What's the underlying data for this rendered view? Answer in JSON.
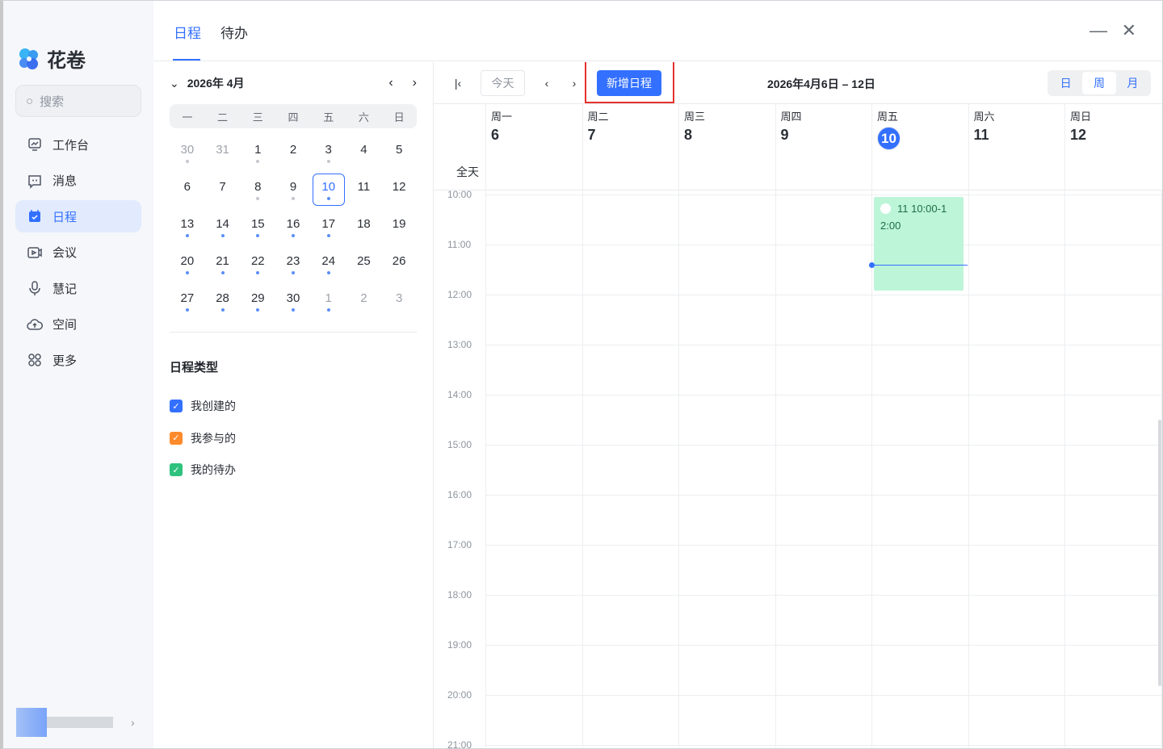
{
  "app": {
    "name": "花卷"
  },
  "sidebar": {
    "search_placeholder": "搜索",
    "items": [
      {
        "label": "工作台",
        "icon": "dashboard-icon"
      },
      {
        "label": "消息",
        "icon": "message-icon"
      },
      {
        "label": "日程",
        "icon": "calendar-icon",
        "active": true
      },
      {
        "label": "会议",
        "icon": "video-icon"
      },
      {
        "label": "慧记",
        "icon": "mic-icon"
      },
      {
        "label": "空间",
        "icon": "cloud-icon"
      },
      {
        "label": "更多",
        "icon": "grid-icon"
      }
    ]
  },
  "tabs": [
    {
      "label": "日程",
      "active": true
    },
    {
      "label": "待办"
    }
  ],
  "window": {
    "minimize": "—",
    "close": "✕"
  },
  "mini_calendar": {
    "title": "2026年 4月",
    "weekdays": [
      "一",
      "二",
      "三",
      "四",
      "五",
      "六",
      "日"
    ],
    "days": [
      {
        "d": "30",
        "o": 1,
        "dot": "g"
      },
      {
        "d": "31",
        "o": 1,
        "dot": "n"
      },
      {
        "d": "1",
        "dot": "g"
      },
      {
        "d": "2",
        "dot": "n"
      },
      {
        "d": "3",
        "dot": "g"
      },
      {
        "d": "4",
        "dot": "n"
      },
      {
        "d": "5",
        "dot": "n"
      },
      {
        "d": "6",
        "dot": "n"
      },
      {
        "d": "7",
        "dot": "n"
      },
      {
        "d": "8",
        "dot": "g"
      },
      {
        "d": "9",
        "dot": "g"
      },
      {
        "d": "10",
        "dot": "b",
        "sel": 1
      },
      {
        "d": "11",
        "dot": "n"
      },
      {
        "d": "12",
        "dot": "n"
      },
      {
        "d": "13",
        "dot": "b"
      },
      {
        "d": "14",
        "dot": "b"
      },
      {
        "d": "15",
        "dot": "b"
      },
      {
        "d": "16",
        "dot": "b"
      },
      {
        "d": "17",
        "dot": "b"
      },
      {
        "d": "18",
        "dot": "n"
      },
      {
        "d": "19",
        "dot": "n"
      },
      {
        "d": "20",
        "dot": "b"
      },
      {
        "d": "21",
        "dot": "b"
      },
      {
        "d": "22",
        "dot": "b"
      },
      {
        "d": "23",
        "dot": "b"
      },
      {
        "d": "24",
        "dot": "b"
      },
      {
        "d": "25",
        "dot": "n"
      },
      {
        "d": "26",
        "dot": "n"
      },
      {
        "d": "27",
        "dot": "b"
      },
      {
        "d": "28",
        "dot": "b"
      },
      {
        "d": "29",
        "dot": "b"
      },
      {
        "d": "30",
        "dot": "b"
      },
      {
        "d": "1",
        "o": 1,
        "dot": "b"
      },
      {
        "d": "2",
        "o": 1,
        "dot": "n"
      },
      {
        "d": "3",
        "o": 1,
        "dot": "n"
      }
    ]
  },
  "schedule_types": {
    "title": "日程类型",
    "items": [
      {
        "label": "我创建的",
        "color": "#3370ff"
      },
      {
        "label": "我参与的",
        "color": "#ff8a2b"
      },
      {
        "label": "我的待办",
        "color": "#2ec27e"
      }
    ]
  },
  "toolbar": {
    "today": "今天",
    "new_event": "新增日程",
    "range": "2026年4月6日 – 12日",
    "views": [
      "日",
      "周",
      "月"
    ],
    "active_view": "周"
  },
  "week": {
    "days": [
      {
        "name": "周一",
        "num": "6"
      },
      {
        "name": "周二",
        "num": "7"
      },
      {
        "name": "周三",
        "num": "8"
      },
      {
        "name": "周四",
        "num": "9"
      },
      {
        "name": "周五",
        "num": "10",
        "today": true
      },
      {
        "name": "周六",
        "num": "11"
      },
      {
        "name": "周日",
        "num": "12"
      }
    ],
    "allday": "全天",
    "hours": [
      "10:00",
      "11:00",
      "12:00",
      "13:00",
      "14:00",
      "15:00",
      "16:00",
      "17:00",
      "18:00",
      "19:00",
      "20:00",
      "21:00"
    ]
  },
  "event": {
    "line1": "11 10:00-1",
    "line2": "2:00",
    "color": "#bdf5d9"
  }
}
